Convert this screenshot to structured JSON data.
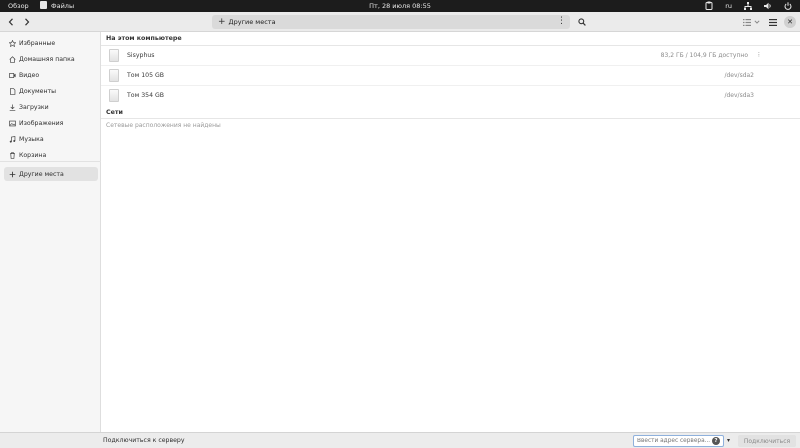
{
  "topbar": {
    "overview": "Обзор",
    "app_name": "Файлы",
    "clock": "Пт, 28 июля  08:55",
    "lang": "ru",
    "icons": [
      "clipboard-icon",
      "network-icon",
      "volume-icon",
      "power-icon"
    ]
  },
  "headerbar": {
    "location_label": "Другие места"
  },
  "sidebar": {
    "items": [
      {
        "label": "Избранные",
        "icon": "star-icon"
      },
      {
        "label": "Домашняя папка",
        "icon": "home-icon"
      },
      {
        "label": "Видео",
        "icon": "video-icon"
      },
      {
        "label": "Документы",
        "icon": "document-icon"
      },
      {
        "label": "Загрузки",
        "icon": "download-icon"
      },
      {
        "label": "Изображения",
        "icon": "image-icon"
      },
      {
        "label": "Музыка",
        "icon": "music-icon"
      },
      {
        "label": "Корзина",
        "icon": "trash-icon"
      }
    ],
    "other": {
      "label": "Другие места",
      "icon": "plus-icon"
    }
  },
  "main": {
    "section_computer": "На этом компьютере",
    "volumes": [
      {
        "name": "Sisyphus",
        "info": "83,2 ГБ / 104,9 ГБ доступно",
        "eject": "⁝"
      },
      {
        "name": "Том 105 GB",
        "info": "/dev/sda2"
      },
      {
        "name": "Том 354 GB",
        "info": "/dev/sda3"
      }
    ],
    "section_networks": "Сети",
    "networks_empty": "Сетевые расположения не найдены"
  },
  "bottombar": {
    "label": "Подключиться к серверу",
    "server_placeholder": "Ввести адрес сервера...",
    "help": "?",
    "connect": "Подключиться"
  }
}
